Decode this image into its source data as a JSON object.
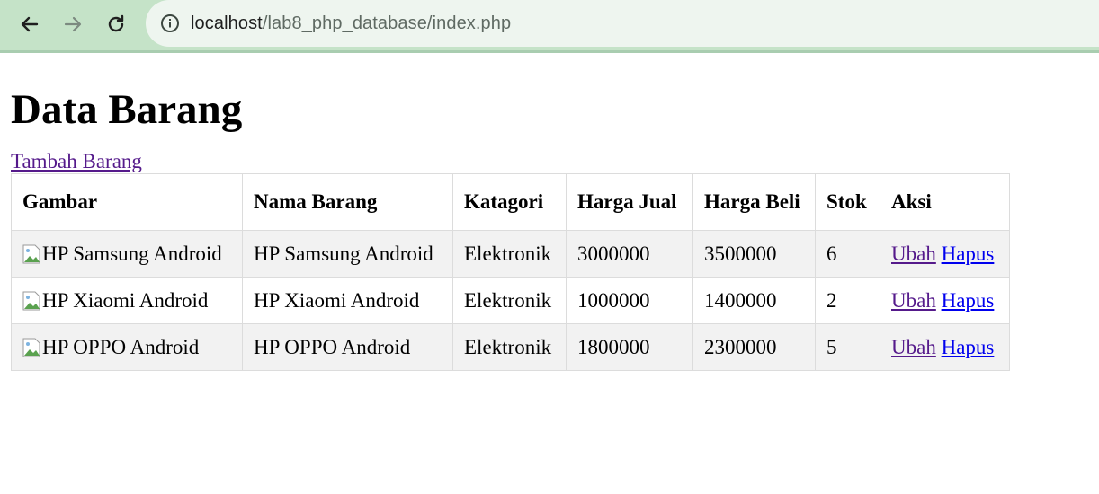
{
  "browser": {
    "url_host": "localhost",
    "url_path": "/lab8_php_database/index.php"
  },
  "page": {
    "title": "Data Barang",
    "add_link": "Tambah Barang"
  },
  "table": {
    "headers": {
      "gambar": "Gambar",
      "nama": "Nama Barang",
      "kategori": "Katagori",
      "harga_jual": "Harga Jual",
      "harga_beli": "Harga Beli",
      "stok": "Stok",
      "aksi": "Aksi"
    },
    "rows": [
      {
        "gambar_alt": "HP Samsung Android",
        "nama": "HP Samsung Android",
        "kategori": "Elektronik",
        "harga_jual": "3000000",
        "harga_beli": "3500000",
        "stok": "6",
        "ubah": "Ubah",
        "hapus": "Hapus"
      },
      {
        "gambar_alt": "HP Xiaomi Android",
        "nama": "HP Xiaomi Android",
        "kategori": "Elektronik",
        "harga_jual": "1000000",
        "harga_beli": "1400000",
        "stok": "2",
        "ubah": "Ubah",
        "hapus": "Hapus"
      },
      {
        "gambar_alt": "HP OPPO Android",
        "nama": "HP OPPO Android",
        "kategori": "Elektronik",
        "harga_jual": "1800000",
        "harga_beli": "2300000",
        "stok": "5",
        "ubah": "Ubah",
        "hapus": "Hapus"
      }
    ]
  }
}
